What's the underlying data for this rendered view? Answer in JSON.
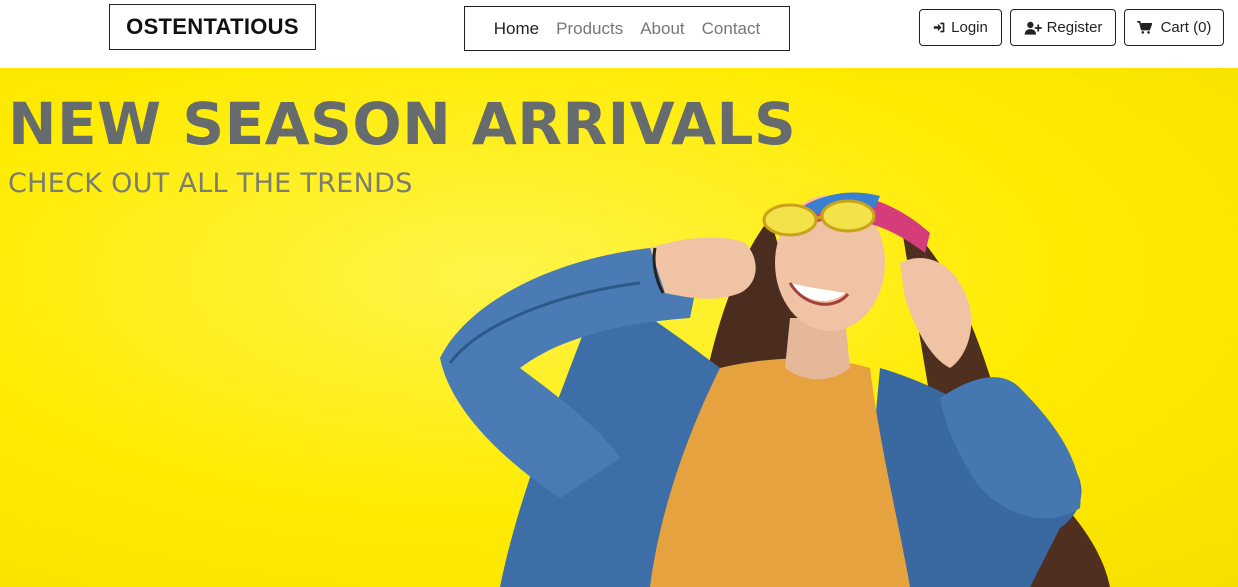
{
  "brand": {
    "name": "OSTENTATIOUS"
  },
  "nav": {
    "links": [
      {
        "label": "Home",
        "active": true
      },
      {
        "label": "Products",
        "active": false
      },
      {
        "label": "About",
        "active": false
      },
      {
        "label": "Contact",
        "active": false
      }
    ]
  },
  "actions": {
    "login": {
      "label": "Login",
      "icon": "sign-in-icon"
    },
    "register": {
      "label": "Register",
      "icon": "user-plus-icon"
    },
    "cart": {
      "label": "Cart (0)",
      "icon": "shopping-cart-icon"
    }
  },
  "hero": {
    "title": "NEW SEASON ARRIVALS",
    "subtitle": "CHECK OUT ALL THE TRENDS",
    "image": "woman-in-denim-jacket-photo"
  },
  "colors": {
    "hero_background": "#ffeb00",
    "hero_text": "#666b6e",
    "border": "#222222",
    "nav_inactive": "#777777",
    "nav_active": "#222222"
  }
}
